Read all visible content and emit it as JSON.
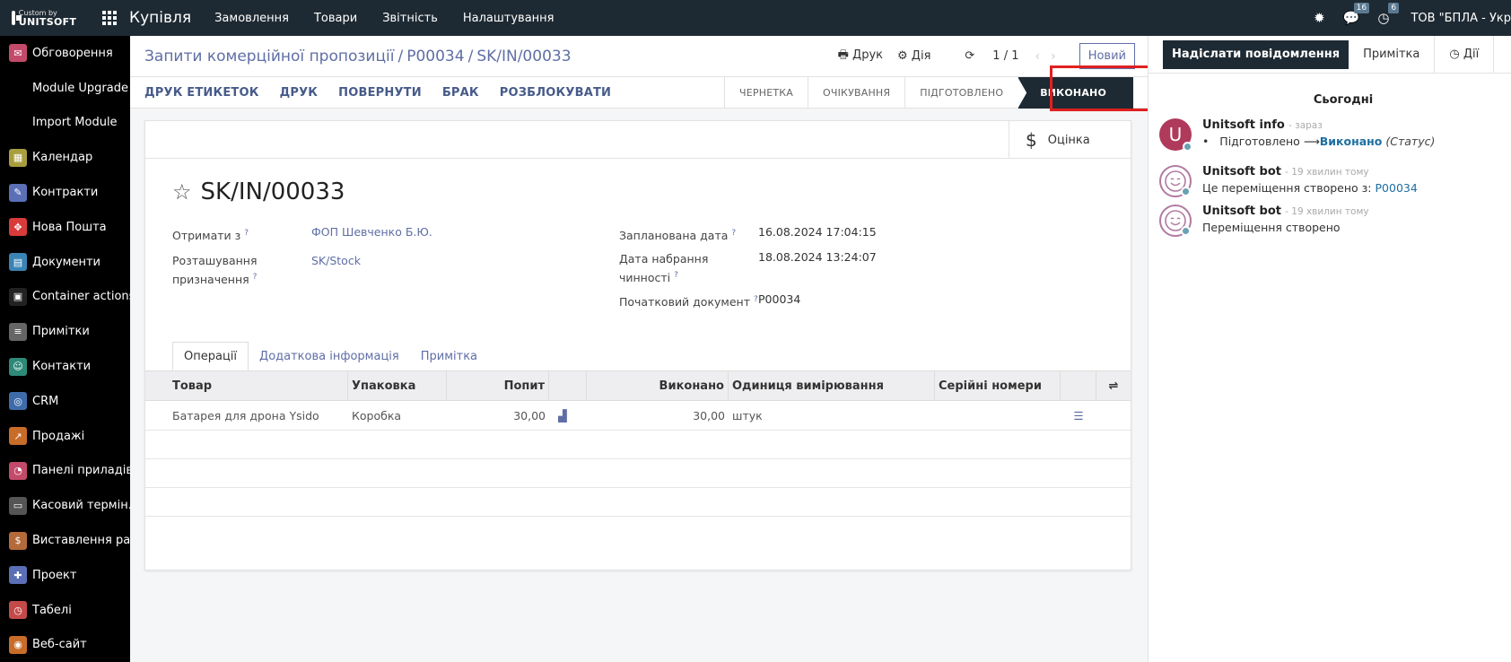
{
  "topbar": {
    "logo_line1": "Custom by",
    "logo_line2": "UNITSOFT",
    "app_title": "Купівля",
    "menu": [
      "Замовлення",
      "Товари",
      "Звітність",
      "Налаштування"
    ],
    "chat_badge": "16",
    "activity_badge": "6",
    "company": "ТОВ \"БПЛА - Укр"
  },
  "sidebar": {
    "items": [
      {
        "label": "Обговорення",
        "icon": "chat-icon",
        "color": "#c44a6a"
      },
      {
        "label": "Module Upgrade",
        "icon": "",
        "color": ""
      },
      {
        "label": "Import Module",
        "icon": "",
        "color": ""
      },
      {
        "label": "Календар",
        "icon": "calendar-icon",
        "color": "#a89e3f"
      },
      {
        "label": "Контракти",
        "icon": "contract-icon",
        "color": "#5a6fb5"
      },
      {
        "label": "Нова Пошта",
        "icon": "nova-poshta-icon",
        "color": "#d93b3b"
      },
      {
        "label": "Документи",
        "icon": "documents-icon",
        "color": "#3a83b5"
      },
      {
        "label": "Container actions",
        "icon": "container-icon",
        "color": "#222"
      },
      {
        "label": "Примітки",
        "icon": "notes-icon",
        "color": "#666"
      },
      {
        "label": "Контакти",
        "icon": "contacts-icon",
        "color": "#2e8a78"
      },
      {
        "label": "CRM",
        "icon": "crm-icon",
        "color": "#3e6cab"
      },
      {
        "label": "Продажі",
        "icon": "sales-icon",
        "color": "#c86c2a"
      },
      {
        "label": "Панелі приладів",
        "icon": "dashboard-icon",
        "color": "#c44a6a"
      },
      {
        "label": "Касовий термін...",
        "icon": "pos-icon",
        "color": "#555"
      },
      {
        "label": "Виставлення ра...",
        "icon": "invoicing-icon",
        "color": "#b46a3a"
      },
      {
        "label": "Проект",
        "icon": "project-icon",
        "color": "#5a6fb5"
      },
      {
        "label": "Табелі",
        "icon": "timesheet-icon",
        "color": "#c44a4a"
      },
      {
        "label": "Веб-сайт",
        "icon": "website-icon",
        "color": "#c86c2a"
      }
    ]
  },
  "control_panel": {
    "breadcrumb": [
      "Запити комерційної пропозиції",
      "P00034",
      "SK/IN/00033"
    ],
    "print": "Друк",
    "action": "Дія",
    "pager": "1 / 1",
    "new_button": "Новий"
  },
  "statusbar": {
    "buttons": [
      "ДРУК ЕТИКЕТОК",
      "ДРУК",
      "ПОВЕРНУТИ",
      "БРАК",
      "РОЗБЛОКУВАТИ"
    ],
    "stages": [
      "ЧЕРНЕТКА",
      "ОЧІКУВАННЯ",
      "ПІДГОТОВЛЕНО",
      "ВИКОНАНО"
    ],
    "active_stage": "ВИКОНАНО"
  },
  "form": {
    "valuation": "Оцінка",
    "title": "SK/IN/00033",
    "receive_from_label": "Отримати з",
    "receive_from_value": "ФОП Шевченко Б.Ю.",
    "dest_label_1": "Розташування",
    "dest_label_2": "призначення",
    "dest_value": "SK/Stock",
    "scheduled_label": "Запланована дата",
    "scheduled_value": "16.08.2024 17:04:15",
    "effective_label_1": "Дата набрання",
    "effective_label_2": "чинності",
    "effective_value": "18.08.2024 13:24:07",
    "origin_label": "Початковий документ",
    "origin_value": "P00034",
    "help_mark": "?",
    "tabs": [
      "Операції",
      "Додаткова інформація",
      "Примітка"
    ],
    "table": {
      "headers": [
        "Товар",
        "Упаковка",
        "Попит",
        "Виконано",
        "Одиниця вимірювання",
        "Серійні номери"
      ],
      "rows": [
        {
          "product": "Батарея для дрона Ysido",
          "package": "Коробка",
          "demand": "30,00",
          "done": "30,00",
          "uom": "штук",
          "serials": ""
        }
      ]
    }
  },
  "chatter": {
    "send_message": "Надіслати повідомлення",
    "note": "Примітка",
    "activities": "Дії",
    "today": "Сьогодні",
    "messages": [
      {
        "author": "Unitsoft info",
        "time": "- зараз",
        "from": "Підготовлено",
        "to": "Виконано",
        "field": "(Статус)"
      },
      {
        "author": "Unitsoft bot",
        "time": "- 19 хвилин тому",
        "text": "Це переміщення створено з:",
        "link": "P00034"
      },
      {
        "author": "Unitsoft bot",
        "time": "- 19 хвилин тому",
        "text": "Переміщення створено"
      }
    ]
  }
}
